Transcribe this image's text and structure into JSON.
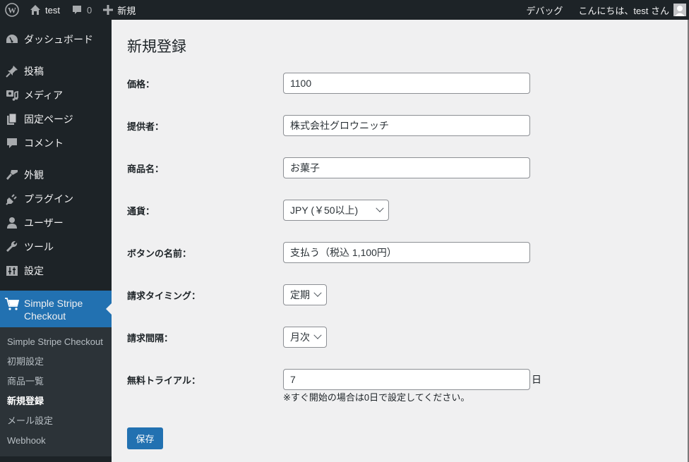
{
  "adminbar": {
    "site_name": "test",
    "comments_count": "0",
    "new_label": "新規",
    "debug_label": "デバッグ",
    "greeting": "こんにちは、test さん"
  },
  "sidebar": {
    "items": [
      {
        "label": "ダッシュボード",
        "icon": "dashboard-icon"
      },
      {
        "label": "投稿",
        "icon": "pin-icon"
      },
      {
        "label": "メディア",
        "icon": "media-icon"
      },
      {
        "label": "固定ページ",
        "icon": "pages-icon"
      },
      {
        "label": "コメント",
        "icon": "comment-icon"
      },
      {
        "label": "外観",
        "icon": "brush-icon"
      },
      {
        "label": "プラグイン",
        "icon": "plugin-icon"
      },
      {
        "label": "ユーザー",
        "icon": "user-icon"
      },
      {
        "label": "ツール",
        "icon": "wrench-icon"
      },
      {
        "label": "設定",
        "icon": "settings-icon"
      }
    ],
    "current": {
      "label": "Simple Stripe Checkout",
      "icon": "cart-icon"
    },
    "submenu": [
      {
        "label": "Simple Stripe Checkout",
        "active": false
      },
      {
        "label": "初期設定",
        "active": false
      },
      {
        "label": "商品一覧",
        "active": false
      },
      {
        "label": "新規登録",
        "active": true
      },
      {
        "label": "メール設定",
        "active": false
      },
      {
        "label": "Webhook",
        "active": false
      }
    ]
  },
  "page": {
    "title": "新規登録",
    "fields": {
      "price": {
        "label": "価格：",
        "value": "1100"
      },
      "provider": {
        "label": "提供者：",
        "value": "株式会社グロウニッチ"
      },
      "product_name": {
        "label": "商品名：",
        "value": "お菓子"
      },
      "currency": {
        "label": "通貨：",
        "selected": "JPY (￥50以上)"
      },
      "button_name": {
        "label": "ボタンの名前：",
        "value": "支払う（税込 1,100円）"
      },
      "billing_timing": {
        "label": "請求タイミング：",
        "selected": "定期"
      },
      "billing_interval": {
        "label": "請求間隔：",
        "selected": "月次"
      },
      "free_trial": {
        "label": "無料トライアル：",
        "value": "7",
        "suffix": "日",
        "hint": "※すぐ開始の場合は0日で設定してください。"
      }
    },
    "save_label": "保存"
  },
  "colors": {
    "accent": "#2271b1",
    "adminbar_bg": "#1d2327",
    "submenu_bg": "#2c3338",
    "content_bg": "#f0f0f1"
  }
}
